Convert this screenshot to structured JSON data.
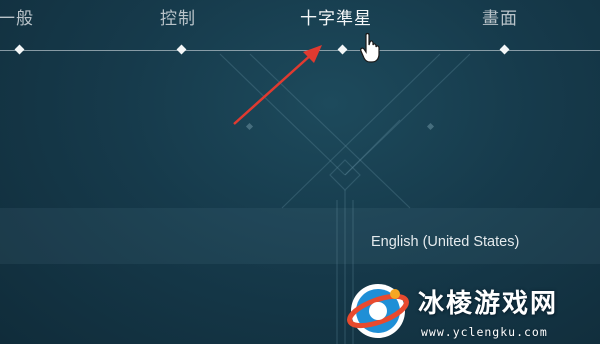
{
  "tabs": [
    {
      "label": "一般",
      "active": false
    },
    {
      "label": "控制",
      "active": false
    },
    {
      "label": "十字準星",
      "active": true
    },
    {
      "label": "畫面",
      "active": false
    }
  ],
  "language": {
    "value": "English (United States)"
  },
  "watermark": {
    "title": "冰棱游戏网",
    "url": "www.yclengku.com"
  },
  "colors": {
    "background": "#163a4b",
    "annotation_arrow": "#e03a30",
    "text": "#e4eaed"
  },
  "icons": {
    "cursor": "hand-pointer-icon",
    "annotation": "red-arrow-icon",
    "logo": "watermark-logo-icon"
  }
}
